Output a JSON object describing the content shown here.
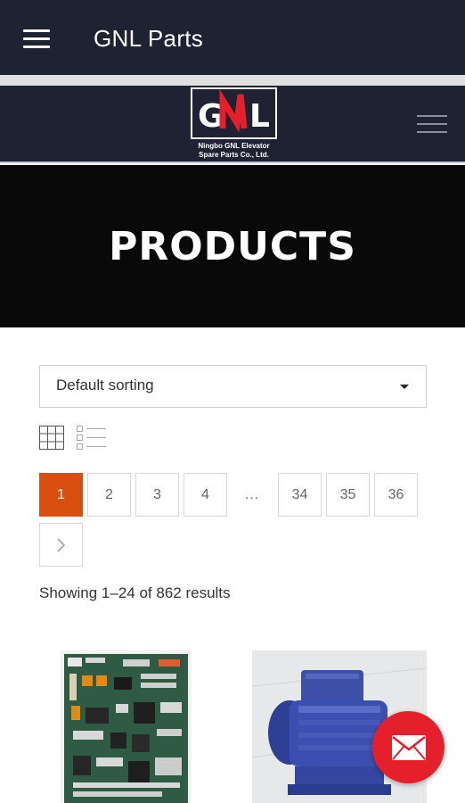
{
  "appbar": {
    "title": "GNL Parts",
    "menu_icon": "hamburger-menu-icon"
  },
  "site_header": {
    "logo_mark": "GNL",
    "logo_line1": "Ningbo GNL Elevator",
    "logo_line2": "Spare Parts Co., Ltd.",
    "menu_icon": "hamburger-menu-icon"
  },
  "hero": {
    "title": "PRODUCTS"
  },
  "sorting": {
    "selected": "Default sorting"
  },
  "view_toggle": {
    "grid_icon": "grid-view-icon",
    "list_icon": "list-view-icon"
  },
  "pagination": {
    "pages": [
      "1",
      "2",
      "3",
      "4",
      "34",
      "35",
      "36"
    ],
    "current": "1",
    "ellipsis": "…",
    "next_icon": "chevron-right-icon"
  },
  "results": {
    "text": "Showing 1–24 of 862 results"
  },
  "products": [
    {
      "image": "circuit-board"
    },
    {
      "image": "blue-motor"
    }
  ],
  "fab": {
    "icon": "mail-icon"
  },
  "colors": {
    "header_bg": "#1e2232",
    "hero_bg": "#090909",
    "accent": "#d94f10",
    "fab": "#e5202a"
  }
}
